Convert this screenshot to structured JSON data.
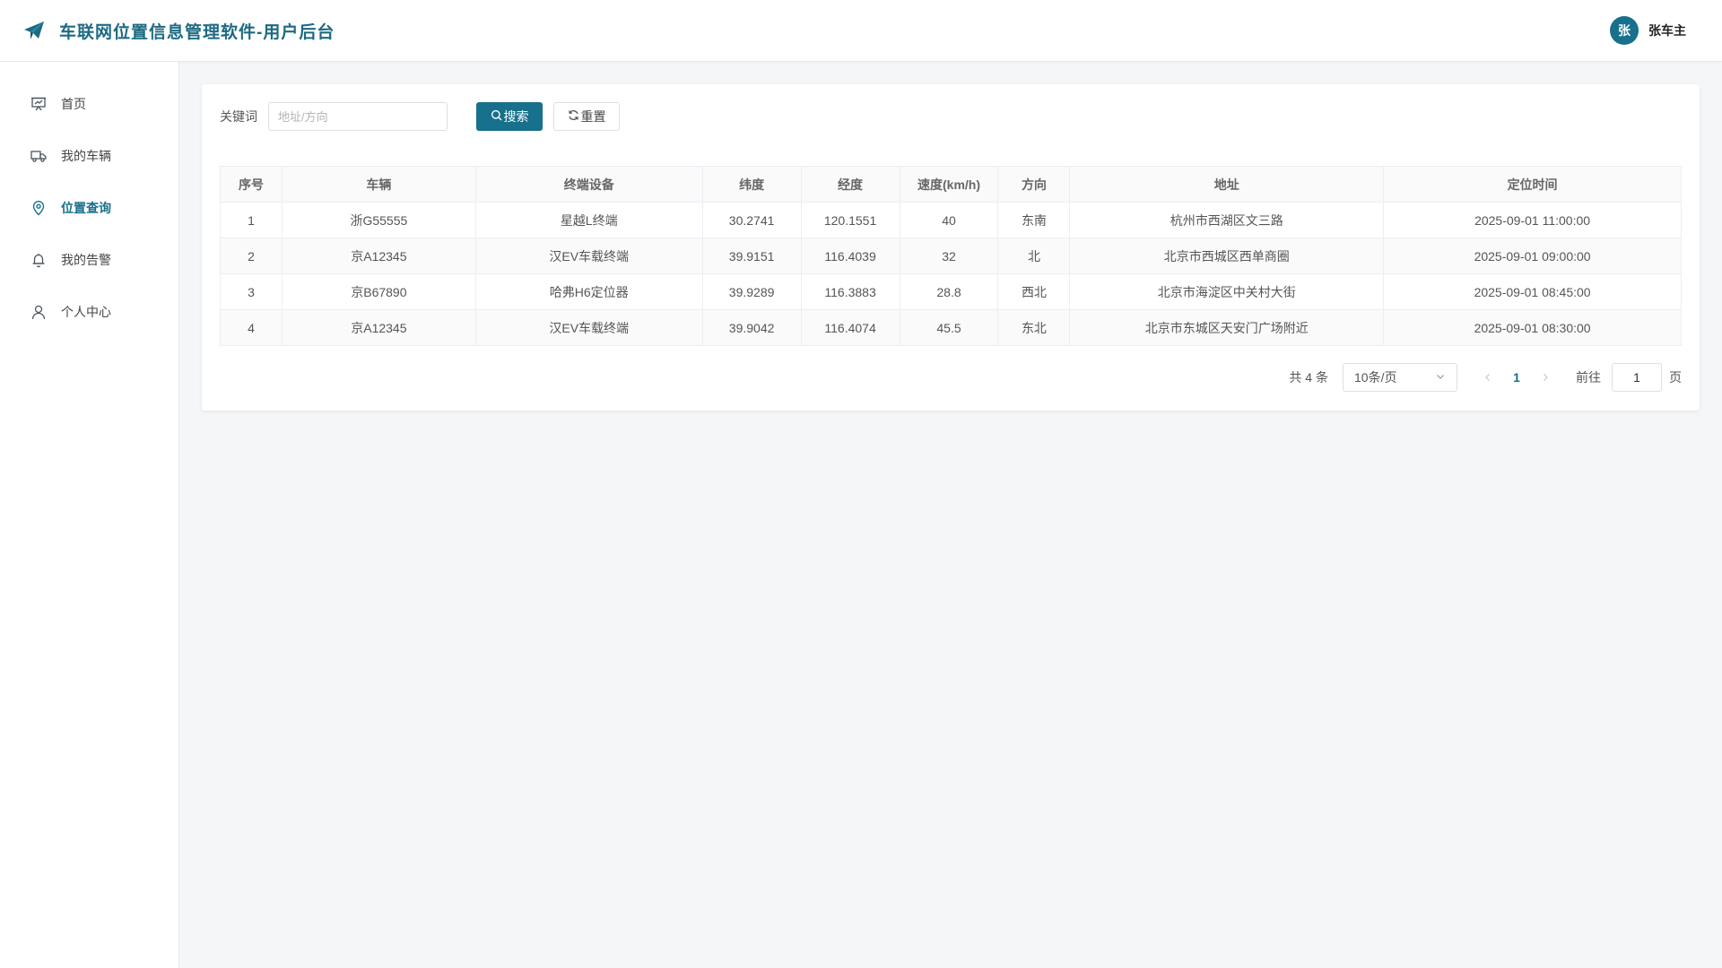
{
  "header": {
    "title": "车联网位置信息管理软件-用户后台",
    "user_avatar": "张",
    "user_name": "张车主"
  },
  "sidebar": {
    "items": [
      {
        "label": "首页",
        "icon": "presentation-icon",
        "active": false
      },
      {
        "label": "我的车辆",
        "icon": "truck-icon",
        "active": false
      },
      {
        "label": "位置查询",
        "icon": "location-pin-icon",
        "active": true
      },
      {
        "label": "我的告警",
        "icon": "bell-icon",
        "active": false
      },
      {
        "label": "个人中心",
        "icon": "user-icon",
        "active": false
      }
    ]
  },
  "search": {
    "label": "关键词",
    "placeholder": "地址/方向",
    "value": "",
    "search_button": "搜索",
    "reset_button": "重置"
  },
  "table": {
    "columns": [
      "序号",
      "车辆",
      "终端设备",
      "纬度",
      "经度",
      "速度(km/h)",
      "方向",
      "地址",
      "定位时间"
    ],
    "rows": [
      [
        "1",
        "浙G55555",
        "星越L终端",
        "30.2741",
        "120.1551",
        "40",
        "东南",
        "杭州市西湖区文三路",
        "2025-09-01 11:00:00"
      ],
      [
        "2",
        "京A12345",
        "汉EV车载终端",
        "39.9151",
        "116.4039",
        "32",
        "北",
        "北京市西城区西单商圈",
        "2025-09-01 09:00:00"
      ],
      [
        "3",
        "京B67890",
        "哈弗H6定位器",
        "39.9289",
        "116.3883",
        "28.8",
        "西北",
        "北京市海淀区中关村大街",
        "2025-09-01 08:45:00"
      ],
      [
        "4",
        "京A12345",
        "汉EV车载终端",
        "39.9042",
        "116.4074",
        "45.5",
        "东北",
        "北京市东城区天安门广场附近",
        "2025-09-01 08:30:00"
      ]
    ]
  },
  "pagination": {
    "total_text": "共 4 条",
    "page_size": "10条/页",
    "current_page": "1",
    "goto_label": "前往",
    "goto_value": "1",
    "page_suffix": "页"
  },
  "colors": {
    "primary": "#17708c",
    "brand_text": "#1d6a82"
  }
}
